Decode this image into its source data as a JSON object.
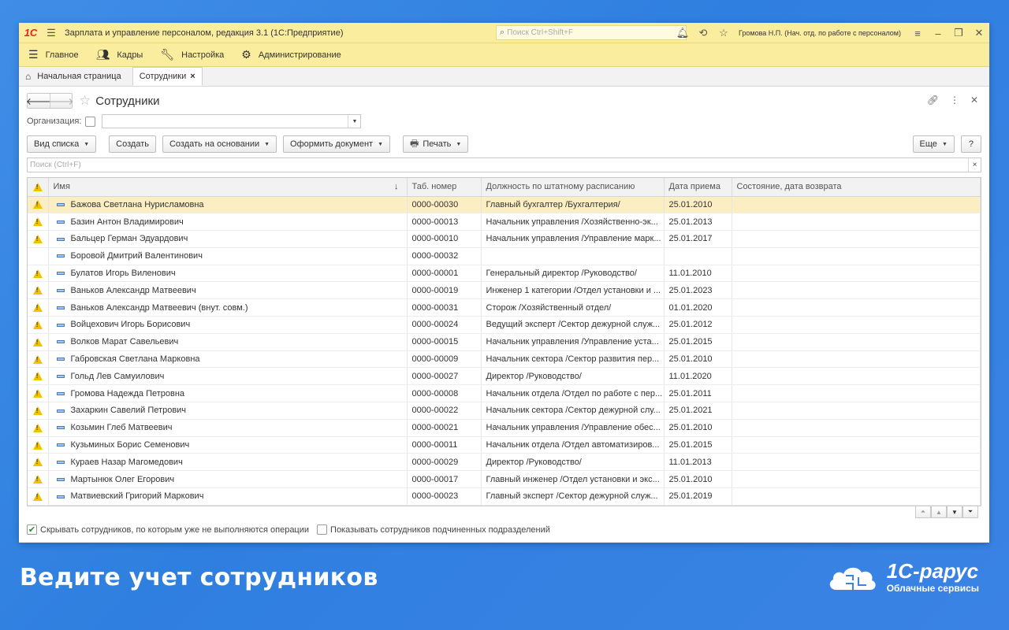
{
  "titlebar": {
    "app_title": "Зарплата и управление персоналом, редакция 3.1  (1С:Предприятие)",
    "search_placeholder": "Поиск Ctrl+Shift+F",
    "user": "Громова Н.П. (Нач. отд. по работе с персоналом)",
    "logo": "1С"
  },
  "menu": {
    "items": [
      {
        "label": "Главное",
        "icon": "hamburger-icon"
      },
      {
        "label": "Кадры",
        "icon": "people-icon"
      },
      {
        "label": "Настройка",
        "icon": "wrench-icon"
      },
      {
        "label": "Администрирование",
        "icon": "gear-icon"
      }
    ]
  },
  "tabs": {
    "home": "Начальная страница",
    "active": "Сотрудники"
  },
  "form": {
    "title": "Сотрудники",
    "org_label": "Организация:",
    "org_value": ""
  },
  "toolbar": {
    "view_list": "Вид списка",
    "create": "Создать",
    "create_based": "Создать на основании",
    "make_doc": "Оформить документ",
    "print": "Печать",
    "more": "Еще",
    "help": "?"
  },
  "search": {
    "placeholder": "Поиск (Ctrl+F)"
  },
  "table": {
    "columns": [
      "Имя",
      "Таб. номер",
      "Должность по штатному расписанию",
      "Дата приема",
      "Состояние, дата возврата"
    ],
    "rows": [
      {
        "warn": true,
        "name": "Бажова Светлана Нурисламовна",
        "num": "0000-00030",
        "pos": "Главный бухгалтер /Бухгалтерия/",
        "date": "25.01.2010",
        "state": ""
      },
      {
        "warn": true,
        "name": "Базин Антон Владимирович",
        "num": "0000-00013",
        "pos": "Начальник управления /Хозяйственно-эк...",
        "date": "25.01.2013",
        "state": ""
      },
      {
        "warn": true,
        "name": "Бальцер Герман Эдуардович",
        "num": "0000-00010",
        "pos": "Начальник управления /Управление марк...",
        "date": "25.01.2017",
        "state": ""
      },
      {
        "warn": false,
        "name": "Боровой Дмитрий Валентинович",
        "num": "0000-00032",
        "pos": "",
        "date": "",
        "state": ""
      },
      {
        "warn": true,
        "name": "Булатов Игорь Виленович",
        "num": "0000-00001",
        "pos": "Генеральный директор /Руководство/",
        "date": "11.01.2010",
        "state": ""
      },
      {
        "warn": true,
        "name": "Ваньков Александр Матвеевич",
        "num": "0000-00019",
        "pos": "Инженер 1 категории /Отдел установки и ...",
        "date": "25.01.2023",
        "state": ""
      },
      {
        "warn": true,
        "name": "Ваньков Александр Матвеевич (внут. совм.)",
        "num": "0000-00031",
        "pos": "Сторож /Хозяйственный отдел/",
        "date": "01.01.2020",
        "state": ""
      },
      {
        "warn": true,
        "name": "Войцехович Игорь Борисович",
        "num": "0000-00024",
        "pos": "Ведущий эксперт /Сектор дежурной служ...",
        "date": "25.01.2012",
        "state": ""
      },
      {
        "warn": true,
        "name": "Волков Марат Савельевич",
        "num": "0000-00015",
        "pos": "Начальник управления /Управление уста...",
        "date": "25.01.2015",
        "state": ""
      },
      {
        "warn": true,
        "name": "Габровская Светлана Марковна",
        "num": "0000-00009",
        "pos": "Начальник сектора /Сектор развития пер...",
        "date": "25.01.2010",
        "state": ""
      },
      {
        "warn": true,
        "name": "Гольд Лев Самуилович",
        "num": "0000-00027",
        "pos": "Директор /Руководство/",
        "date": "11.01.2020",
        "state": ""
      },
      {
        "warn": true,
        "name": "Громова Надежда Петровна",
        "num": "0000-00008",
        "pos": "Начальник отдела /Отдел по работе с пер...",
        "date": "25.01.2011",
        "state": ""
      },
      {
        "warn": true,
        "name": "Захаркин Савелий Петрович",
        "num": "0000-00022",
        "pos": "Начальник сектора /Сектор дежурной слу...",
        "date": "25.01.2021",
        "state": ""
      },
      {
        "warn": true,
        "name": "Козьмин Глеб Матвеевич",
        "num": "0000-00021",
        "pos": "Начальник управления /Управление обес...",
        "date": "25.01.2010",
        "state": ""
      },
      {
        "warn": true,
        "name": "Кузьминых Борис Семенович",
        "num": "0000-00011",
        "pos": "Начальник отдела /Отдел автоматизиров...",
        "date": "25.01.2015",
        "state": ""
      },
      {
        "warn": true,
        "name": "Кураев Назар Магомедович",
        "num": "0000-00029",
        "pos": "Директор /Руководство/",
        "date": "11.01.2013",
        "state": ""
      },
      {
        "warn": true,
        "name": "Мартынюк Олег Егорович",
        "num": "0000-00017",
        "pos": "Главный инженер /Отдел установки и экс...",
        "date": "25.01.2010",
        "state": ""
      },
      {
        "warn": true,
        "name": "Матвиевский Григорий Маркович",
        "num": "0000-00023",
        "pos": "Главный эксперт /Сектор дежурной служ...",
        "date": "25.01.2019",
        "state": ""
      }
    ]
  },
  "bottom": {
    "hide_label": "Скрывать сотрудников, по которым уже не выполняются операции",
    "hide_checked": true,
    "show_sub_label": "Показывать сотрудников подчиненных подразделений",
    "show_sub_checked": false
  },
  "footer": {
    "tagline": "Ведите учет сотрудников",
    "brand_name": "1С-рарус",
    "brand_sub": "Облачные сервисы"
  },
  "colors": {
    "title_bar": "#fbed9e",
    "selected_row": "#fbeec2",
    "background": "#3a85e4"
  }
}
